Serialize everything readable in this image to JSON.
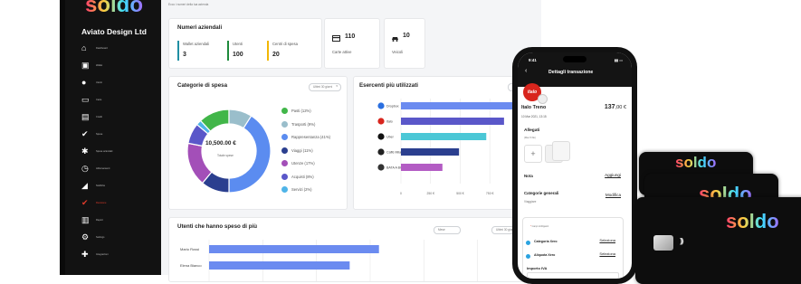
{
  "brand": {
    "logo": "soldo",
    "company": "Aviato Design Ltd"
  },
  "sidebar": {
    "items": [
      {
        "label": "Dashboard",
        "icon": "home-icon"
      },
      {
        "label": "Wallet",
        "icon": "wallet-icon"
      },
      {
        "label": "Utenti",
        "icon": "user-icon"
      },
      {
        "label": "Carte",
        "icon": "card-icon"
      },
      {
        "label": "Credit",
        "icon": "credit-icon"
      },
      {
        "label": "Spese",
        "icon": "check-list-icon"
      },
      {
        "label": "Spese aziendali",
        "icon": "gear-icon"
      },
      {
        "label": "Abbonamenti",
        "icon": "clock-icon"
      },
      {
        "label": "Notifiche",
        "icon": "megaphone-icon"
      },
      {
        "label": "Revisione",
        "icon": "checkmark-icon",
        "active": true
      },
      {
        "label": "Report",
        "icon": "bar-chart-icon"
      },
      {
        "label": "Settings",
        "icon": "settings-icon"
      },
      {
        "label": "Integrazioni",
        "icon": "puzzle-icon"
      }
    ]
  },
  "dashboard": {
    "breadcrumb": "Ecco i numeri della tua azienda",
    "numeri": {
      "title": "Numeri aziendali",
      "items": [
        {
          "label": "Wallet aziendali",
          "value": "3",
          "color": "#1f8fa3"
        },
        {
          "label": "Utenti",
          "value": "100",
          "color": "#1e8a3c"
        },
        {
          "label": "Centri di spesa",
          "value": "20",
          "color": "#f2b705"
        }
      ]
    },
    "carte": {
      "value": "110",
      "label": "Carte attive"
    },
    "veicoli": {
      "value": "10",
      "label": "Veicoli"
    },
    "categorie": {
      "title": "Categorie di spesa",
      "dropdown": "Ultimi 30 giorni",
      "total": "10,500.00 €",
      "total_label": "Totale spese",
      "chart_data": {
        "type": "pie",
        "labels": [
          "Pasti (12%)",
          "Trasporti (9%)",
          "Rappresentanza (41%)",
          "Viaggi (11%)",
          "Utenze (17%)",
          "Acquisti (8%)",
          "Servizi (2%)"
        ],
        "values": [
          12,
          9,
          41,
          11,
          17,
          8,
          2
        ],
        "colors": [
          "#41b649",
          "#9abecb",
          "#5b8cf0",
          "#2b3f8f",
          "#a34fb8",
          "#5a57c9",
          "#4fb4e8"
        ]
      }
    },
    "esercenti": {
      "title": "Esercenti più utilizzati",
      "dropdown": "Ultimi 30 giorni",
      "chart_data": {
        "type": "bar",
        "orientation": "horizontal",
        "categories": [
          "Dropbox",
          "Italo",
          "Uber",
          "Caffè Milano",
          "BATA A BCI7..."
        ],
        "values": [
          1080,
          870,
          720,
          490,
          350
        ],
        "colors": [
          "#6b8bf0",
          "#5a57c9",
          "#4bc7d6",
          "#2b3f8f",
          "#b35cc4"
        ],
        "xticks": [
          "0",
          "250 €",
          "500 €",
          "750 €",
          "1,000 €"
        ],
        "xlim": [
          0,
          1100
        ]
      }
    },
    "utenti": {
      "title": "Utenti che hanno speso di più",
      "dropdown1": "Mese",
      "dropdown2": "Ultimi 30 giorni",
      "chart_data": {
        "type": "bar",
        "orientation": "horizontal",
        "categories": [
          "Mario Rossi",
          "Elena Bianco"
        ],
        "values": [
          580,
          480
        ],
        "colors": [
          "#6b8bf0",
          "#6b8bf0"
        ]
      }
    }
  },
  "phone": {
    "time": "9:41",
    "header_title": "Dettagli transazione",
    "merchant_badge": "italo",
    "merchant": "Italo Treno",
    "amount_int": "137",
    "amount_dec": ",00 €",
    "date": "10 Mar 2021, 13:15",
    "allegati_title": "Allegati",
    "allegati_sub": "(Max 5 file)",
    "nota_label": "Nota",
    "nota_action": "Aggiungi",
    "categorie_label": "Categorie generali",
    "categorie_action": "Modifica",
    "categorie_value": "Viaggiare",
    "box_required": "Campi obbligatori",
    "row1_label": "Categoria Xero",
    "row1_action": "Seleziona",
    "row2_label": "Aliquota Xero",
    "row2_action": "Seleziona",
    "iva_label": "Importo IVA"
  },
  "cards": {
    "logo": "soldo",
    "contactless": "))))"
  },
  "colors": {
    "accent": "#e23b2a",
    "sidebar_bg": "#121212"
  }
}
